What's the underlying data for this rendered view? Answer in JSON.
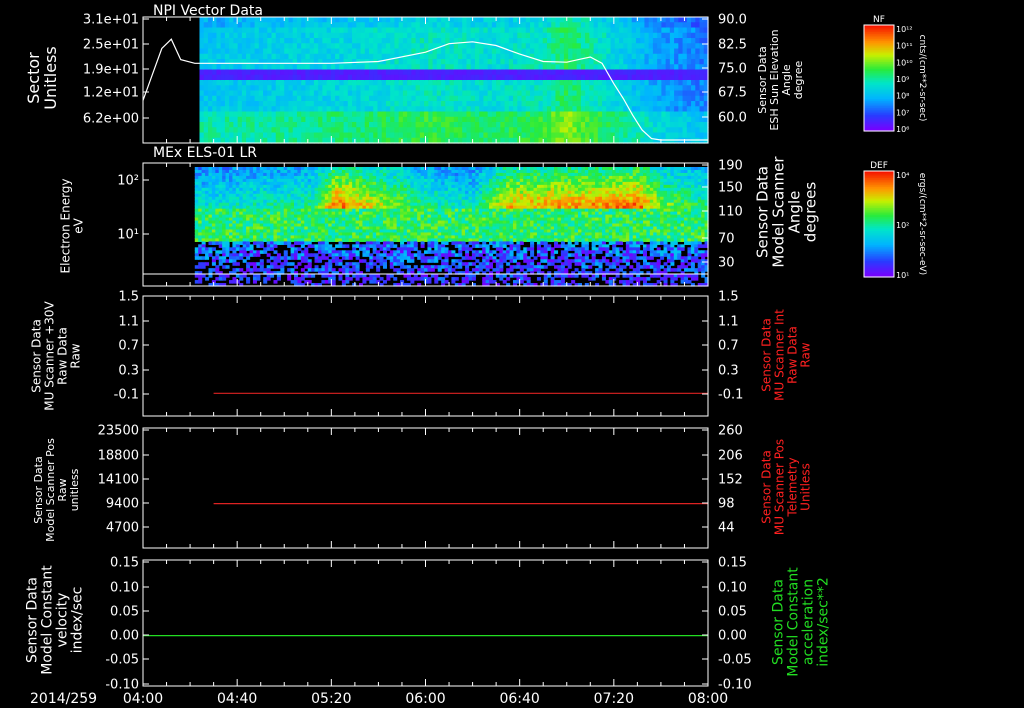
{
  "colors": {
    "background": "#000000",
    "axis": "#ffffff",
    "red_trace": "#dd2222",
    "green_trace": "#22dd22",
    "red_label": "#ff2020",
    "green_label": "#22dd22"
  },
  "date_label": "2014/259",
  "time_axis": {
    "ticks": [
      "04:00",
      "04:40",
      "05:20",
      "06:00",
      "06:40",
      "07:20",
      "08:00"
    ],
    "range_minutes": [
      240,
      480
    ]
  },
  "panels": {
    "p1": {
      "title": "NPI Vector Data",
      "left_label": [
        "Sector",
        "Unitless"
      ],
      "left_ticks": [
        "3.1e+01",
        "2.5e+01",
        "1.9e+01",
        "1.2e+01",
        "6.2e+00"
      ],
      "right_label": [
        "Sensor Data",
        "ESH Sun Elevation",
        "Angle",
        "degree"
      ],
      "right_ticks": [
        "90.0",
        "82.5",
        "75.0",
        "67.5",
        "60.0"
      ],
      "colorbar": {
        "title": "NF",
        "ticks": [
          "10¹²",
          "10¹¹",
          "10¹⁰",
          "10⁹",
          "10⁸",
          "10⁷",
          "10⁶"
        ],
        "units": "cnts/(cm**2-sr-sec)"
      }
    },
    "p2": {
      "title": "MEx ELS-01 LR",
      "left_label": [
        "Electron Energy",
        "eV"
      ],
      "left_ticks": [
        "10²",
        "10¹"
      ],
      "right_label": [
        "Sensor Data",
        "Model Scanner",
        "Angle",
        "degrees"
      ],
      "right_ticks": [
        "190",
        "150",
        "110",
        "70",
        "30"
      ],
      "colorbar": {
        "title": "DEF",
        "ticks": [
          "10⁴",
          "10²",
          "10¹"
        ],
        "units": "ergs/(cm**2-sr-sec-eV)"
      }
    },
    "p3": {
      "left_label": [
        "Sensor Data",
        "MU Scanner +30V",
        "Raw Data",
        "Raw"
      ],
      "left_ticks": [
        "1.5",
        "1.1",
        "0.7",
        "0.3",
        "-0.1"
      ],
      "right_label": [
        "Sensor Data",
        "MU Scanner Int",
        "Raw Data",
        "Raw"
      ],
      "right_ticks": [
        "1.5",
        "1.1",
        "0.7",
        "0.3",
        "-0.1"
      ]
    },
    "p4": {
      "left_label": [
        "Sensor Data",
        "Model Scanner Pos",
        "Raw",
        "unitless"
      ],
      "left_ticks": [
        "23500",
        "18800",
        "14100",
        "9400",
        "4700"
      ],
      "right_label": [
        "Sensor Data",
        "MU Scanner Pos",
        "Telemetry",
        "Unitless"
      ],
      "right_ticks": [
        "260",
        "206",
        "152",
        "98",
        "44"
      ]
    },
    "p5": {
      "left_label": [
        "Sensor Data",
        "Model Constant",
        "velocity",
        "index/sec"
      ],
      "left_ticks": [
        "0.15",
        "0.10",
        "0.05",
        "0.00",
        "-0.05",
        "-0.10"
      ],
      "right_label": [
        "Sensor Data",
        "Model Constant",
        "acceleration",
        "index/sec**2"
      ],
      "right_ticks": [
        "0.15",
        "0.10",
        "0.05",
        "0.00",
        "-0.05",
        "-0.10"
      ]
    }
  },
  "chart_data": [
    {
      "type": "line",
      "panel": "p1",
      "x_unit": "minutes since 00:00",
      "ylim": [
        56,
        90
      ],
      "series": [
        {
          "x": [
            240,
            244,
            248,
            252,
            256,
            262,
            270,
            280,
            300,
            320,
            340,
            360,
            370,
            380,
            390,
            400,
            410,
            420,
            425,
            430,
            435,
            440,
            444,
            448,
            452,
            456,
            460,
            470,
            480
          ],
          "values": [
            67.5,
            74.5,
            81.5,
            84.0,
            78.5,
            77.5,
            77.5,
            77.5,
            77.5,
            77.5,
            78.0,
            80.5,
            82.8,
            83.3,
            82.3,
            80.0,
            78.0,
            77.8,
            78.5,
            79.2,
            77.5,
            72.0,
            68.0,
            63.5,
            59.5,
            57.2,
            56.8,
            56.8,
            56.8
          ]
        }
      ]
    },
    {
      "type": "heatmap",
      "panel": "p1",
      "x_range": [
        264,
        480
      ],
      "rows": 24,
      "intensity_profile": {
        "x": [
          264,
          300,
          330,
          360,
          390,
          410,
          420,
          440,
          460,
          480
        ],
        "values": [
          0.35,
          0.38,
          0.4,
          0.45,
          0.42,
          0.45,
          0.55,
          0.4,
          0.28,
          0.22
        ]
      }
    },
    {
      "type": "heatmap",
      "panel": "p2",
      "x_range": [
        262,
        480
      ],
      "energy_range_eV": [
        1.5,
        190
      ],
      "intensity_profile": {
        "x": [
          262,
          290,
          312,
          322,
          345,
          360,
          380,
          395,
          420,
          440,
          450,
          460,
          480
        ],
        "values": [
          0.45,
          0.5,
          0.55,
          0.95,
          0.72,
          0.55,
          0.45,
          0.85,
          0.9,
          0.92,
          0.98,
          0.7,
          0.55
        ]
      }
    },
    {
      "type": "line",
      "panel": "p3",
      "ylim": [
        -0.3,
        1.5
      ],
      "series": [
        {
          "x": [
            270,
            480
          ],
          "values": [
            0.04,
            0.04
          ]
        }
      ]
    },
    {
      "type": "line",
      "panel": "p4",
      "ylim": [
        0,
        23500
      ],
      "series": [
        {
          "x": [
            270,
            480
          ],
          "values": [
            8700,
            8700
          ]
        }
      ]
    },
    {
      "type": "line",
      "panel": "p5",
      "ylim": [
        -0.1,
        0.15
      ],
      "series": [
        {
          "x": [
            240,
            480
          ],
          "values": [
            0.0,
            0.0
          ]
        }
      ]
    }
  ]
}
